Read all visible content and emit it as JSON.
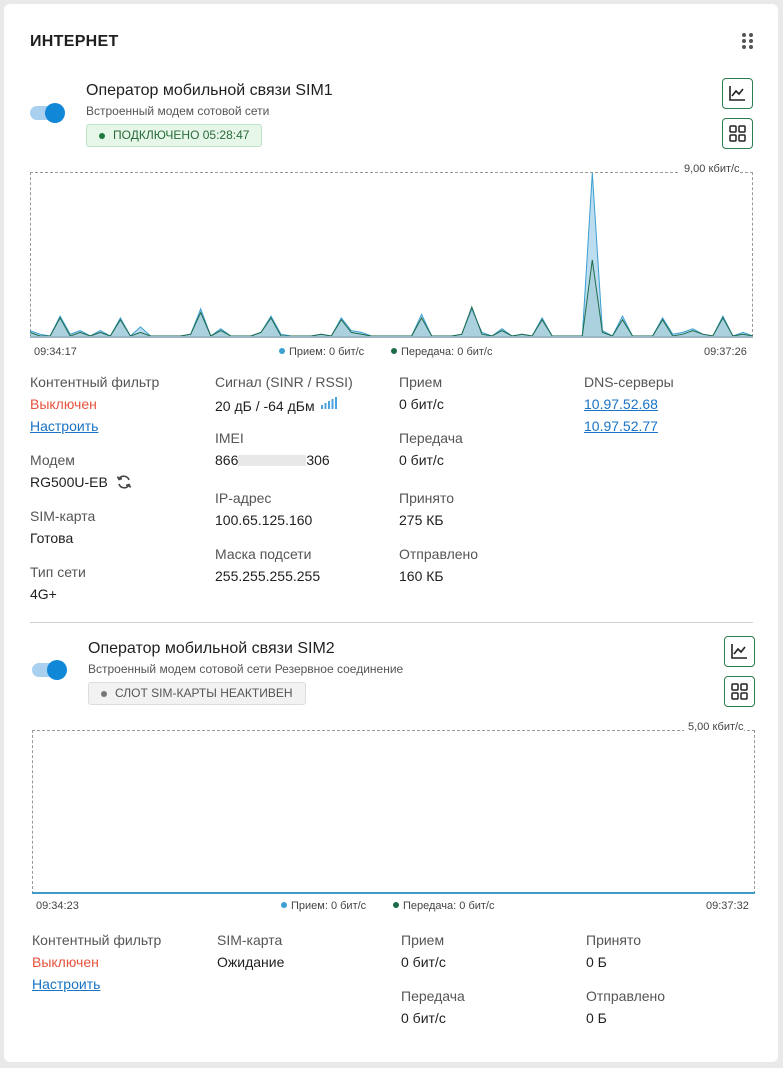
{
  "page": {
    "title": "ИНТЕРНЕТ"
  },
  "colors": {
    "accent": "#1187d8",
    "rx": "#3b9fd1",
    "tx": "#1e6b4a",
    "ok": "#1e7a3a",
    "off": "#e5533d",
    "link": "#1a73c4"
  },
  "sim1": {
    "title": "Оператор мобильной связи SIM1",
    "subtitle": "Встроенный модем сотовой сети",
    "status": "ПОДКЛЮЧЕНО 05:28:47",
    "enabled": true,
    "chart": {
      "max_label": "9,00 кбит/с",
      "time_start": "09:34:17",
      "time_end": "09:37:26",
      "legend_rx": "Прием: 0 бит/с",
      "legend_tx": "Передача: 0 бит/с"
    },
    "content_filter": {
      "label": "Контентный фильтр",
      "value": "Выключен",
      "link": "Настроить"
    },
    "modem": {
      "label": "Модем",
      "value": "RG500U-EB"
    },
    "sim_card": {
      "label": "SIM-карта",
      "value": "Готова"
    },
    "network_type": {
      "label": "Тип сети",
      "value": "4G+"
    },
    "signal": {
      "label": "Сигнал (SINR / RSSI)",
      "value": "20 дБ / -64 дБм"
    },
    "imei": {
      "label": "IMEI",
      "prefix": "866",
      "suffix": "306"
    },
    "ip": {
      "label": "IP-адрес",
      "value": "100.65.125.160"
    },
    "mask": {
      "label": "Маска подсети",
      "value": "255.255.255.255"
    },
    "rx": {
      "label": "Прием",
      "value": "0 бит/с"
    },
    "tx": {
      "label": "Передача",
      "value": "0 бит/с"
    },
    "received": {
      "label": "Принято",
      "value": "275 КБ"
    },
    "sent": {
      "label": "Отправлено",
      "value": "160 КБ"
    },
    "dns": {
      "label": "DNS-серверы",
      "servers": [
        "10.97.52.68",
        "10.97.52.77"
      ]
    }
  },
  "sim2": {
    "title": "Оператор мобильной связи SIM2",
    "subtitle": "Встроенный модем сотовой сети Резервное соединение",
    "status": "СЛОТ SIM-КАРТЫ НЕАКТИВЕН",
    "enabled": true,
    "chart": {
      "max_label": "5,00 кбит/с",
      "time_start": "09:34:23",
      "time_end": "09:37:32",
      "legend_rx": "Прием: 0 бит/с",
      "legend_tx": "Передача: 0 бит/с"
    },
    "content_filter": {
      "label": "Контентный фильтр",
      "value": "Выключен",
      "link": "Настроить"
    },
    "sim_card": {
      "label": "SIM-карта",
      "value": "Ожидание"
    },
    "rx": {
      "label": "Прием",
      "value": "0 бит/с"
    },
    "tx": {
      "label": "Передача",
      "value": "0 бит/с"
    },
    "received": {
      "label": "Принято",
      "value": "0 Б"
    },
    "sent": {
      "label": "Отправлено",
      "value": "0 Б"
    }
  },
  "chart_data": [
    {
      "type": "area",
      "ylim": [
        0,
        9
      ],
      "y_unit": "кбит/с",
      "x_range": [
        "09:34:17",
        "09:37:26"
      ],
      "series": [
        {
          "name": "Прием",
          "values": [
            0.3,
            0.1,
            0,
            1.1,
            0.1,
            0.3,
            0,
            0.3,
            0,
            1,
            0,
            0.5,
            0,
            0,
            0,
            0,
            0.1,
            1.5,
            0,
            0.4,
            0,
            0,
            0,
            0.2,
            1.1,
            0.1,
            0,
            0,
            0,
            0.1,
            0,
            1,
            0.3,
            0.2,
            0,
            0,
            0,
            0,
            0,
            1.2,
            0,
            0,
            0,
            0.1,
            1.5,
            0.2,
            0,
            0.4,
            0,
            0.1,
            0,
            1,
            0,
            0,
            0,
            0,
            9,
            0.3,
            0,
            1.1,
            0,
            0,
            0,
            1,
            0.1,
            0.2,
            0.4,
            0.1,
            0,
            1.1,
            0,
            0.2,
            0
          ]
        },
        {
          "name": "Передача",
          "values": [
            0.2,
            0,
            0,
            1,
            0,
            0.2,
            0,
            0.2,
            0,
            0.9,
            0,
            0.2,
            0,
            0,
            0,
            0,
            0.1,
            1.3,
            0,
            0.3,
            0,
            0,
            0,
            0.2,
            1,
            0,
            0,
            0,
            0,
            0.1,
            0,
            0.9,
            0.2,
            0.1,
            0,
            0,
            0,
            0,
            0,
            1,
            0,
            0,
            0,
            0.1,
            1.6,
            0.1,
            0,
            0.3,
            0,
            0.1,
            0,
            0.9,
            0,
            0,
            0,
            0,
            4.2,
            0.2,
            0,
            0.9,
            0,
            0,
            0,
            0.9,
            0,
            0.1,
            0.3,
            0.1,
            0,
            1,
            0,
            0.1,
            0
          ]
        }
      ]
    },
    {
      "type": "area",
      "ylim": [
        0,
        5
      ],
      "y_unit": "кбит/с",
      "x_range": [
        "09:34:23",
        "09:37:32"
      ],
      "series": [
        {
          "name": "Прием",
          "values": [
            0,
            0
          ]
        },
        {
          "name": "Передача",
          "values": [
            0,
            0
          ]
        }
      ]
    }
  ]
}
